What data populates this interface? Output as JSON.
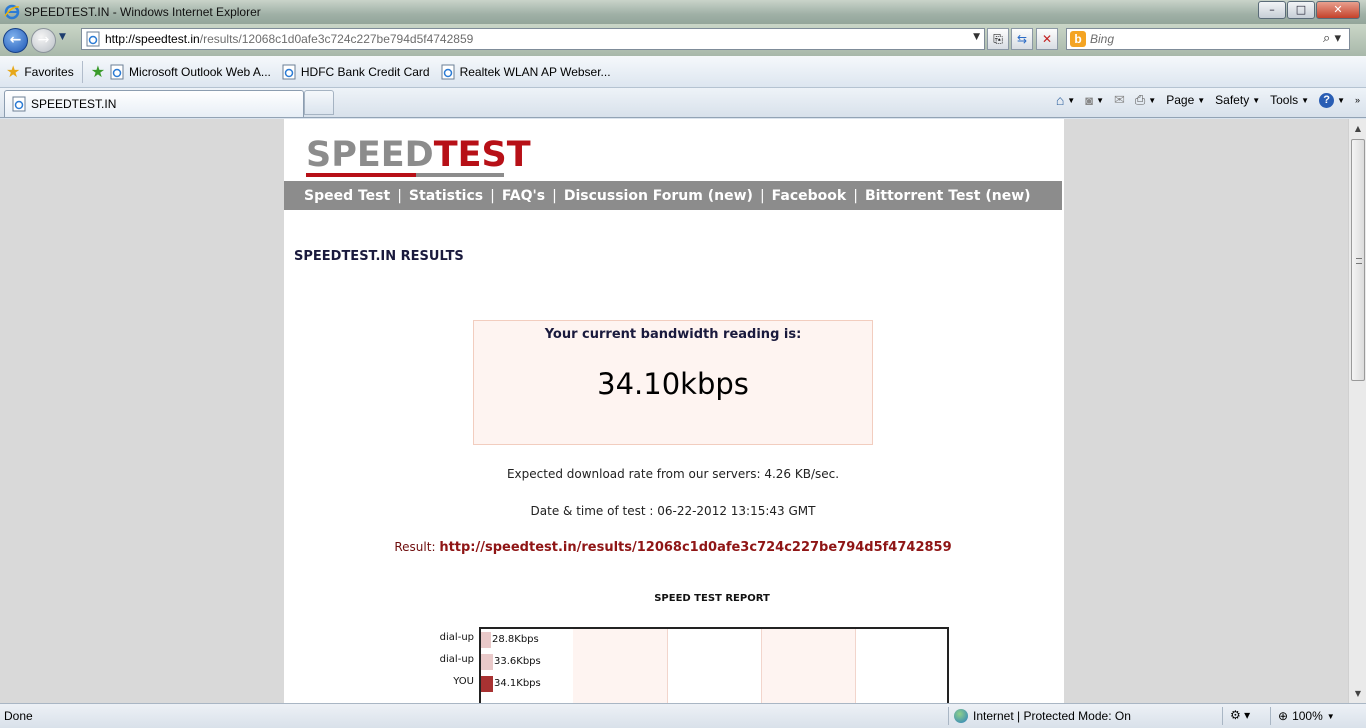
{
  "window": {
    "title": "SPEEDTEST.IN - Windows Internet Explorer",
    "min": "–",
    "max": "□",
    "close": "✕"
  },
  "address": {
    "prefix": "http://speedtest.in",
    "path": "/results/12068c1d0afe3c724c227be794d5f4742859"
  },
  "search": {
    "placeholder": "Bing"
  },
  "favorites": {
    "label": "Favorites",
    "links": [
      "Microsoft Outlook Web A...",
      "HDFC Bank Credit Card",
      "Realtek WLAN AP Webser..."
    ]
  },
  "tab": {
    "label": "SPEEDTEST.IN"
  },
  "commands": {
    "page": "Page",
    "safety": "Safety",
    "tools": "Tools"
  },
  "site": {
    "logo_gray": "SPEED",
    "logo_red": "TEST",
    "menu": [
      "Speed Test",
      "Statistics",
      "FAQ's",
      "Discussion Forum (new)",
      "Facebook",
      "Bittorrent Test (new)"
    ],
    "results_title": "SPEEDTEST.IN RESULTS",
    "bandwidth_label": "Your current bandwidth reading is:",
    "bandwidth_value": "34.10kbps",
    "expected": "Expected download rate from our servers: 4.26 KB/sec.",
    "datetime": "Date & time of test : 06-22-2012 13:15:43 GMT",
    "result_label": "Result:",
    "result_link": "http://speedtest.in/results/12068c1d0afe3c724c227be794d5f4742859",
    "report_title": "SPEED TEST REPORT",
    "chart_rows": [
      {
        "label": "dial-up",
        "value": "28.8Kbps"
      },
      {
        "label": "dial-up",
        "value": "33.6Kbps"
      },
      {
        "label": "YOU",
        "value": "34.1Kbps"
      }
    ]
  },
  "chart_data": {
    "type": "bar",
    "title": "SPEED TEST REPORT",
    "categories": [
      "dial-up",
      "dial-up",
      "YOU"
    ],
    "values": [
      28.8,
      33.6,
      34.1
    ],
    "unit": "Kbps",
    "colors": {
      "reference": "#e9c9c9",
      "you": "#a83232"
    }
  },
  "status": {
    "left": "Done",
    "zone": "Internet | Protected Mode: On",
    "zoom": "100%"
  }
}
